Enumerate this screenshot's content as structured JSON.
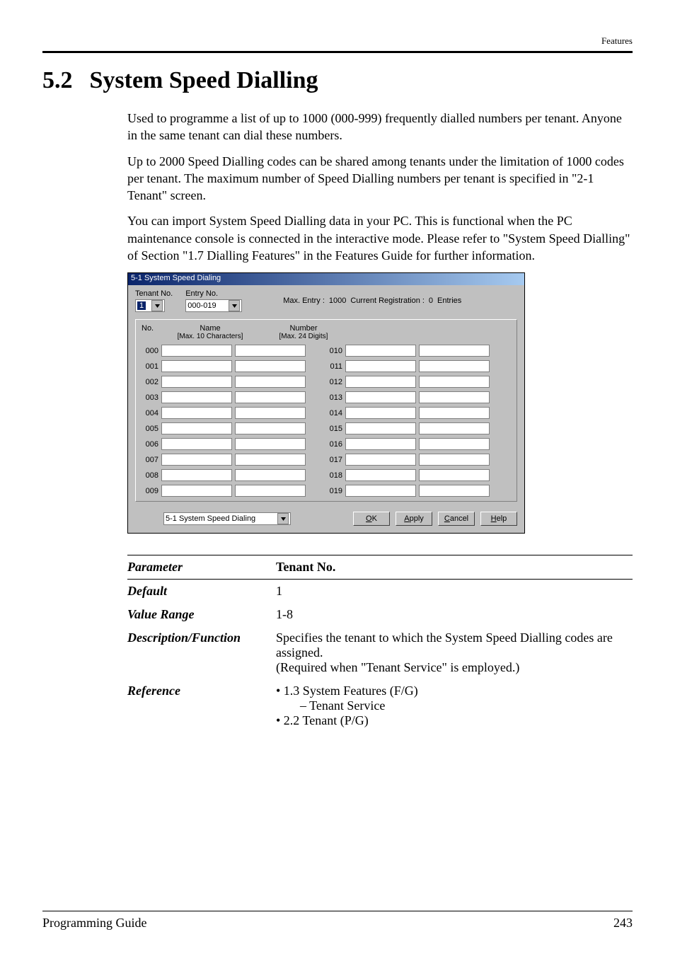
{
  "page": {
    "top_label": "Features",
    "section_number": "5.2",
    "section_name": "System Speed Dialling"
  },
  "body": {
    "p1": "Used to programme a list of up to 1000 (000-999) frequently dialled numbers per tenant. Anyone in the same tenant can dial these numbers.",
    "p2": "Up to 2000 Speed Dialling codes can be shared among tenants under the limitation of 1000 codes per tenant. The maximum number of Speed Dialling numbers per tenant is specified in \"2-1 Tenant\" screen.",
    "p3": "You can import System Speed Dialling data in your PC. This is functional when the PC maintenance console is connected in the interactive mode. Please refer to \"System Speed Dialling\" of Section \"1.7 Dialling Features\" in the Features Guide for further information."
  },
  "dialog": {
    "title": "5-1 System Speed Dialing",
    "tenant_label": "Tenant No.",
    "tenant_value": "1",
    "entry_label": "Entry No.",
    "entry_value": "000-019",
    "max_entry_label": "Max. Entry :",
    "max_entry_value": "1000",
    "current_reg_label": "Current Registration :",
    "current_reg_value": "0",
    "entries_label": "Entries",
    "col_no": "No.",
    "col_name": "Name",
    "col_name_sub": "[Max. 10 Characters]",
    "col_number": "Number",
    "col_number_sub": "[Max. 24 Digits]",
    "left_ids": [
      "000",
      "001",
      "002",
      "003",
      "004",
      "005",
      "006",
      "007",
      "008",
      "009"
    ],
    "right_ids": [
      "010",
      "011",
      "012",
      "013",
      "014",
      "015",
      "016",
      "017",
      "018",
      "019"
    ],
    "bottom_select": "5-1 System Speed Dialing",
    "btn_ok_prefix": "O",
    "btn_ok_rest": "K",
    "btn_apply_prefix": "A",
    "btn_apply_rest": "pply",
    "btn_cancel_prefix": "C",
    "btn_cancel_rest": "ancel",
    "btn_help_prefix": "H",
    "btn_help_rest": "elp"
  },
  "table": {
    "h_parameter": "Parameter",
    "h_name": "Tenant No.",
    "l_default": "Default",
    "v_default": "1",
    "l_range": "Value Range",
    "v_range": "1-8",
    "l_desc": "Description/Function",
    "v_desc1": "Specifies the tenant to which the System Speed Dialling codes are assigned.",
    "v_desc2": "(Required when \"Tenant Service\" is employed.)",
    "l_ref": "Reference",
    "v_ref1": "• 1.3 System Features (F/G)",
    "v_ref1a": "– Tenant Service",
    "v_ref2": "• 2.2   Tenant (P/G)"
  },
  "footer": {
    "left": "Programming Guide",
    "right": "243"
  }
}
